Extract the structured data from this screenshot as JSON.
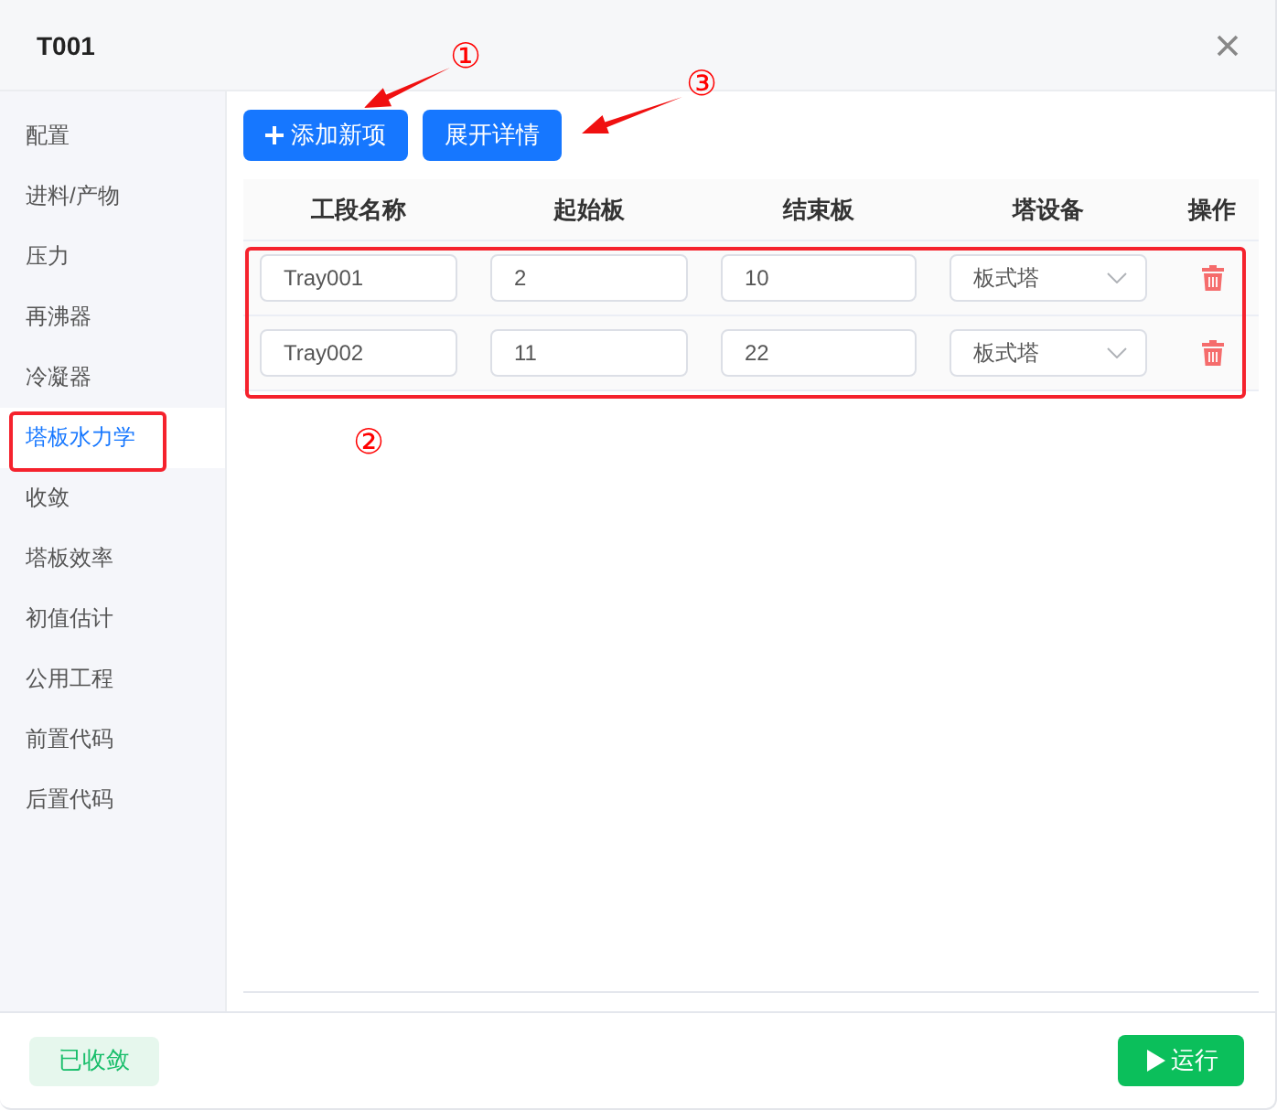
{
  "window": {
    "title": "T001"
  },
  "sidebar": {
    "items": [
      {
        "label": "配置",
        "selected": false,
        "highlighted": false
      },
      {
        "label": "进料/产物",
        "selected": false,
        "highlighted": false
      },
      {
        "label": "压力",
        "selected": false,
        "highlighted": false
      },
      {
        "label": "再沸器",
        "selected": false,
        "highlighted": false
      },
      {
        "label": "冷凝器",
        "selected": false,
        "highlighted": false
      },
      {
        "label": "塔板水力学",
        "selected": true,
        "highlighted": true
      },
      {
        "label": "收敛",
        "selected": false,
        "highlighted": false
      },
      {
        "label": "塔板效率",
        "selected": false,
        "highlighted": false
      },
      {
        "label": "初值估计",
        "selected": false,
        "highlighted": false
      },
      {
        "label": "公用工程",
        "selected": false,
        "highlighted": false
      },
      {
        "label": "前置代码",
        "selected": false,
        "highlighted": false
      },
      {
        "label": "后置代码",
        "selected": false,
        "highlighted": false
      }
    ]
  },
  "toolbar": {
    "buttons": [
      {
        "label": "添加新项",
        "kind": "add"
      },
      {
        "label": "展开详情",
        "kind": "plain"
      }
    ]
  },
  "table": {
    "highlighted": true,
    "columns": [
      "工段名称",
      "起始板",
      "结束板",
      "塔设备",
      "操作"
    ],
    "rows": [
      {
        "name": "Tray001",
        "start": "2",
        "end": "10",
        "equipment": "板式塔"
      },
      {
        "name": "Tray002",
        "start": "11",
        "end": "22",
        "equipment": "板式塔"
      }
    ]
  },
  "footer": {
    "status": "已收敛",
    "run_button": "运行"
  },
  "annotations": [
    {
      "label": "①",
      "kind": "arrow"
    },
    {
      "label": "②",
      "kind": "number"
    },
    {
      "label": "③",
      "kind": "arrow"
    }
  ]
}
